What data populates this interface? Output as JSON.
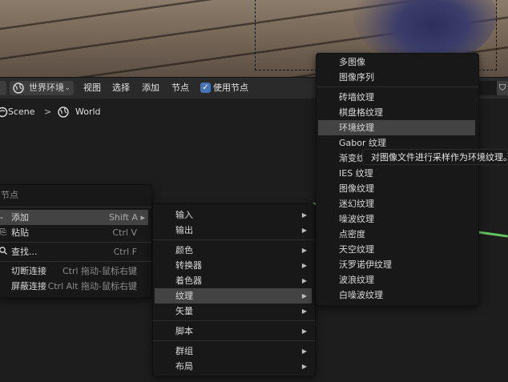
{
  "header": {
    "world_dropdown": "世界环境",
    "menus": [
      "视图",
      "选择",
      "添加",
      "节点"
    ],
    "use_nodes_label": "使用节点",
    "use_nodes_checked": true
  },
  "breadcrumb": {
    "scene": "Scene",
    "separator": ">",
    "world": "World"
  },
  "main_menu": {
    "title": "节点",
    "items": [
      {
        "label": "添加",
        "shortcut": "Shift A ▸",
        "icon": "plus-icon"
      },
      {
        "label": "粘贴",
        "shortcut": "Ctrl V",
        "icon": "paste-icon"
      },
      {
        "label": "查找...",
        "shortcut": "Ctrl F",
        "icon": "search-icon"
      },
      {
        "label": "切断连接",
        "shortcut": "Ctrl 拖动-鼠标右键"
      },
      {
        "label": "屏蔽连接",
        "shortcut": "Ctrl Alt 拖动-鼠标右键"
      }
    ]
  },
  "category_menu": {
    "items": [
      "输入",
      "输出",
      "颜色",
      "转换器",
      "着色器",
      "纹理",
      "矢量",
      "脚本",
      "群组",
      "布局"
    ],
    "highlighted": "纹理"
  },
  "texture_menu": {
    "items": [
      "多图像",
      "图像序列",
      "砖墙纹理",
      "棋盘格纹理",
      "环境纹理",
      "Gabor 纹理",
      "渐变纹理",
      "IES 纹理",
      "图像纹理",
      "迷幻纹理",
      "噪波纹理",
      "点密度",
      "天空纹理",
      "沃罗诺伊纹理",
      "波浪纹理",
      "白噪波纹理"
    ],
    "highlighted": "环境纹理"
  },
  "tooltip": "对图像文件进行采样作为环境纹理。",
  "colors": {
    "accent": "#4772b3",
    "link_green": "#62c462",
    "menu_bg": "#181818",
    "highlight": "#434343"
  }
}
